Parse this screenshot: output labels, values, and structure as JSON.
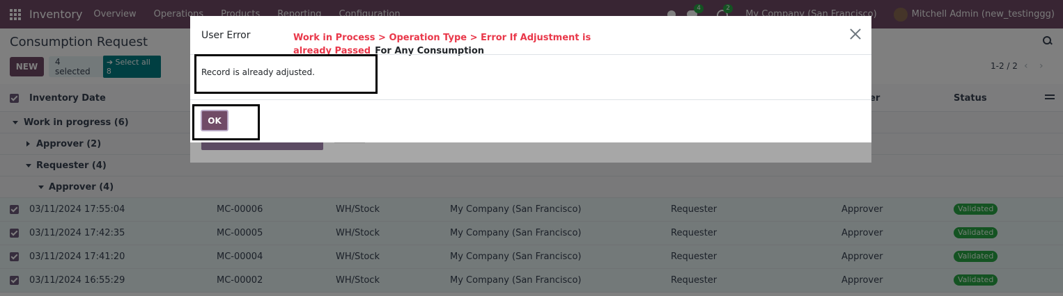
{
  "navbar": {
    "app_title": "Inventory",
    "menu": [
      "Overview",
      "Operations",
      "Products",
      "Reporting",
      "Configuration"
    ],
    "chat_badge": "4",
    "activity_badge": "2",
    "company": "My Company (San Francisco)",
    "user": "Mitchell Admin (new_testinggg)"
  },
  "control_panel": {
    "breadcrumb": "Consumption Request",
    "new_label": "NEW",
    "selected_label": "4 selected",
    "select_all_label": "Select all 8",
    "pager": "1-2 / 2"
  },
  "list": {
    "columns": {
      "date": "Inventory Date",
      "approver": "er",
      "status": "Status"
    },
    "groups": [
      {
        "label": "Work in progress (6)"
      },
      {
        "label": "Approver (2)"
      },
      {
        "label": "Requester (4)"
      },
      {
        "label": "Approver (4)"
      }
    ],
    "rows": [
      {
        "date": "03/11/2024 17:55:04",
        "ref": "MC-00006",
        "location": "WH/Stock",
        "company": "My Company (San Francisco)",
        "requester": "Requester",
        "approver": "Approver",
        "status": "Validated"
      },
      {
        "date": "03/11/2024 17:42:35",
        "ref": "MC-00005",
        "location": "WH/Stock",
        "company": "My Company (San Francisco)",
        "requester": "Requester",
        "approver": "Approver",
        "status": "Validated"
      },
      {
        "date": "03/11/2024 17:41:20",
        "ref": "MC-00004",
        "location": "WH/Stock",
        "company": "My Company (San Francisco)",
        "requester": "Requester",
        "approver": "Approver",
        "status": "Validated"
      },
      {
        "date": "03/11/2024 16:55:29",
        "ref": "MC-00002",
        "location": "WH/Stock",
        "company": "My Company (San Francisco)",
        "requester": "Requester",
        "approver": "Approver",
        "status": "Validated"
      }
    ]
  },
  "dialog": {
    "title": "User Error",
    "annotation_red": "Work in Process > Operation Type > Error If Adjustment is already Passed",
    "annotation_black": "For Any Consumption",
    "message": "Record is already adjusted.",
    "ok_label": "OK"
  },
  "colors": {
    "brand": "#714b67",
    "annotation": "#e9384a",
    "status_validated": "#28a745",
    "selected_row": "#e6f2f3"
  }
}
